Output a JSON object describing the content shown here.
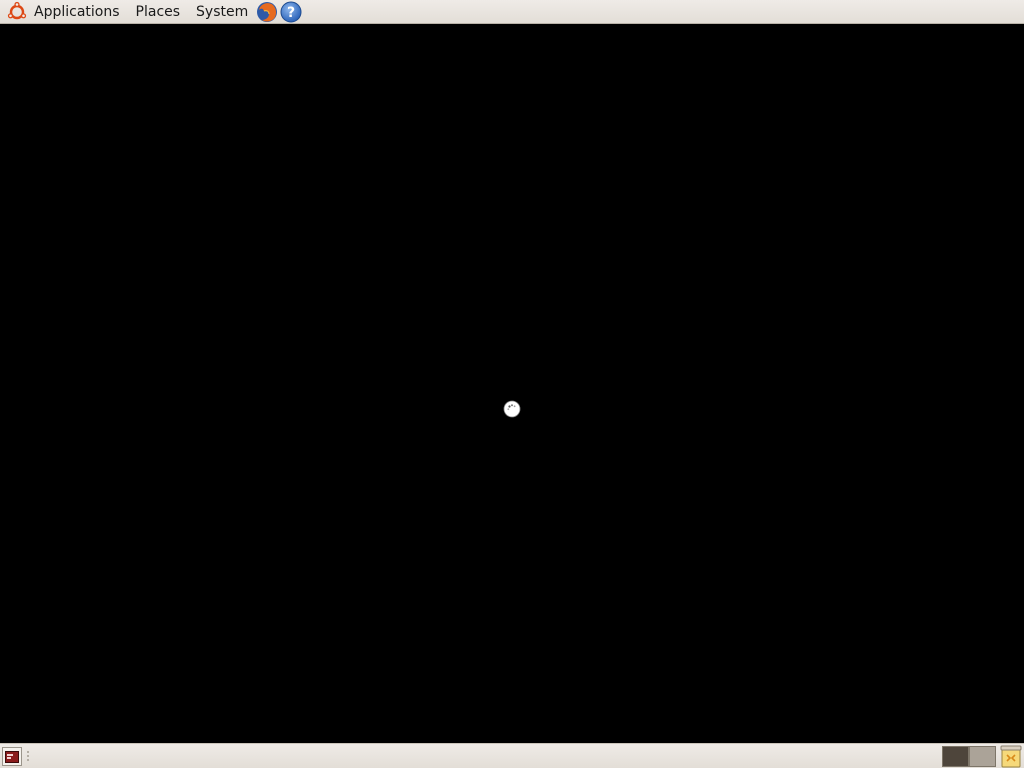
{
  "top_panel": {
    "menus": {
      "applications": "Applications",
      "places": "Places",
      "system": "System"
    },
    "launchers": [
      "firefox-icon",
      "help-icon"
    ]
  },
  "desktop": {
    "background": "#000000",
    "cursor": "busy-cursor"
  },
  "bottom_panel": {
    "workspaces": [
      "workspace-1",
      "workspace-2"
    ],
    "active_workspace": 1
  },
  "colors": {
    "panel": "#e8e4de",
    "ubuntu_orange": "#dd4814",
    "help_blue": "#3a7bd5"
  }
}
